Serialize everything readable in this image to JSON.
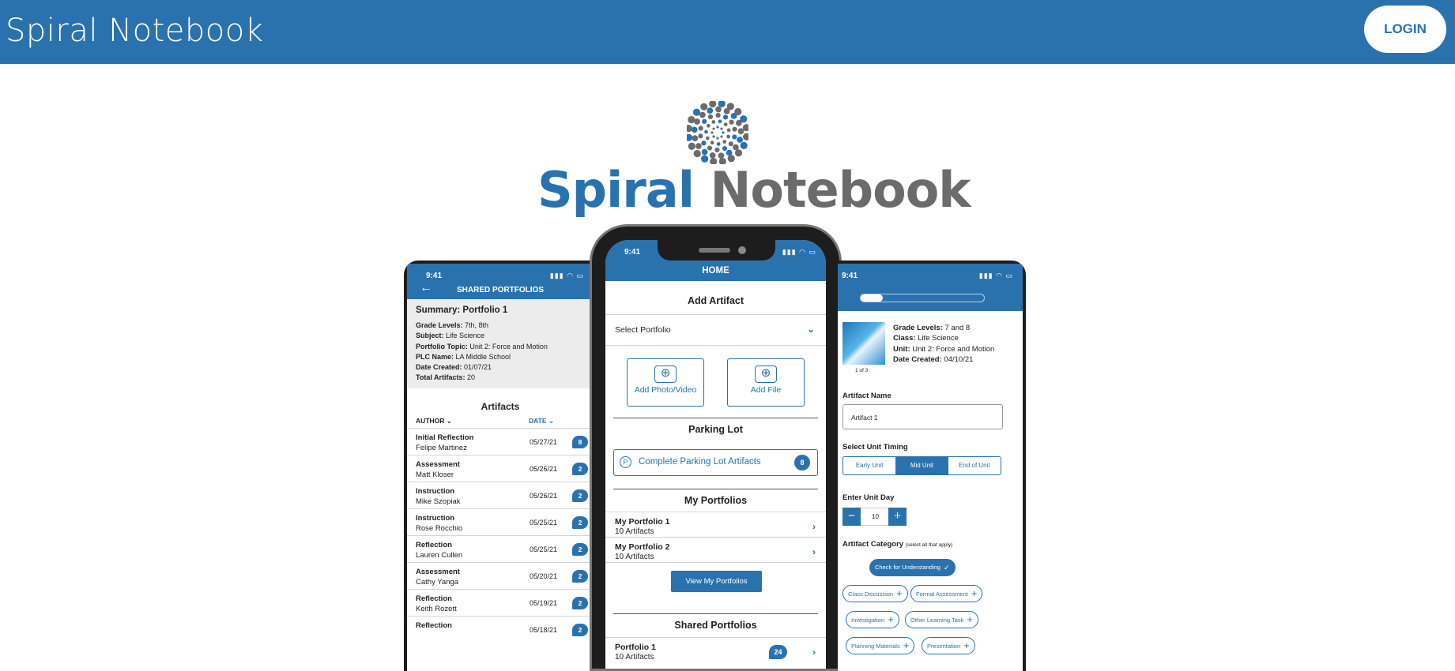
{
  "topbar": {
    "brand": "Spiral Notebook",
    "login_label": "LOGIN"
  },
  "logo": {
    "word_a": "Spiral",
    "word_b": "Notebook"
  },
  "colors": {
    "brand_blue": "#2a72ae",
    "logo_gray": "#6b6b6b"
  },
  "left_phone": {
    "time": "9:41",
    "title": "SHARED PORTFOLIOS",
    "summary_title": "Summary: Portfolio 1",
    "summary": [
      {
        "k": "Grade Levels:",
        "v": "7th, 8th"
      },
      {
        "k": "Subject:",
        "v": "Life Science"
      },
      {
        "k": "Portfolio Topic:",
        "v": "Unit 2: Force and Motion"
      },
      {
        "k": "PLC Name:",
        "v": "LA Middle School"
      },
      {
        "k": "Date Created:",
        "v": "01/07/21"
      },
      {
        "k": "Total Artifacts:",
        "v": "20"
      }
    ],
    "artifacts_title": "Artifacts",
    "col_author": "AUTHOR",
    "col_date": "DATE",
    "rows": [
      {
        "type": "Initial Reflection",
        "author": "Felipe Martinez",
        "date": "05/27/21",
        "comments": "8"
      },
      {
        "type": "Assessment",
        "author": "Matt Kloser",
        "date": "05/26/21",
        "comments": "2"
      },
      {
        "type": "Instruction",
        "author": "Mike Szopiak",
        "date": "05/26/21",
        "comments": "2"
      },
      {
        "type": "Instruction",
        "author": "Rose Rocchio",
        "date": "05/25/21",
        "comments": "2"
      },
      {
        "type": "Reflection",
        "author": "Lauren Cullen",
        "date": "05/25/21",
        "comments": "2"
      },
      {
        "type": "Assessment",
        "author": "Cathy Yanga",
        "date": "05/20/21",
        "comments": "2"
      },
      {
        "type": "Reflection",
        "author": "Keith Rozett",
        "date": "05/19/21",
        "comments": "2"
      },
      {
        "type": "Reflection",
        "author": "",
        "date": "05/18/21",
        "comments": "2"
      }
    ]
  },
  "center_phone": {
    "time": "9:41",
    "title": "HOME",
    "add_artifact": "Add Artifact",
    "select_portfolio": "Select Portfolio",
    "add_photo": "Add Photo/Video",
    "add_file": "Add File",
    "parking_lot": "Parking Lot",
    "complete_parking": "Complete Parking Lot Artifacts",
    "parking_count": "8",
    "my_portfolios": "My Portfolios",
    "portfolios": [
      {
        "name": "My Portfolio 1",
        "count": "10 Artifacts"
      },
      {
        "name": "My Portfolio 2",
        "count": "10 Artifacts"
      }
    ],
    "view_my": "View My Portfolios",
    "shared_portfolios": "Shared Portfolios",
    "shared": [
      {
        "name": "Portfolio 1",
        "count": "10 Artifacts",
        "comments": "24"
      }
    ]
  },
  "right_phone": {
    "time": "9:41",
    "progress": 0.18,
    "thumb_caption": "1 of 3",
    "meta": [
      {
        "k": "Grade Levels:",
        "v": "7 and 8"
      },
      {
        "k": "Class:",
        "v": "Life Science"
      },
      {
        "k": "Unit:",
        "v": "Unit 2: Force and Motion"
      },
      {
        "k": "Date Created:",
        "v": "04/10/21"
      }
    ],
    "artifact_name_label": "Artifact Name",
    "artifact_name_value": "Artifact 1",
    "timing_label": "Select Unit Timing",
    "timing": [
      "Early Unit",
      "Mid Unit",
      "End of Unit"
    ],
    "timing_selected": "Mid Unit",
    "unit_day_label": "Enter Unit Day",
    "unit_day_value": "10",
    "category_label": "Artifact Category",
    "category_hint": "(select all that apply)",
    "categories": [
      {
        "label": "Check for Understanding",
        "selected": true
      },
      {
        "label": "Class Discussion",
        "selected": false
      },
      {
        "label": "Formal Assessment",
        "selected": false
      },
      {
        "label": "Investigation",
        "selected": false
      },
      {
        "label": "Other Learning Task",
        "selected": false
      },
      {
        "label": "Planning Materials",
        "selected": false
      },
      {
        "label": "Presentation",
        "selected": false
      }
    ]
  }
}
